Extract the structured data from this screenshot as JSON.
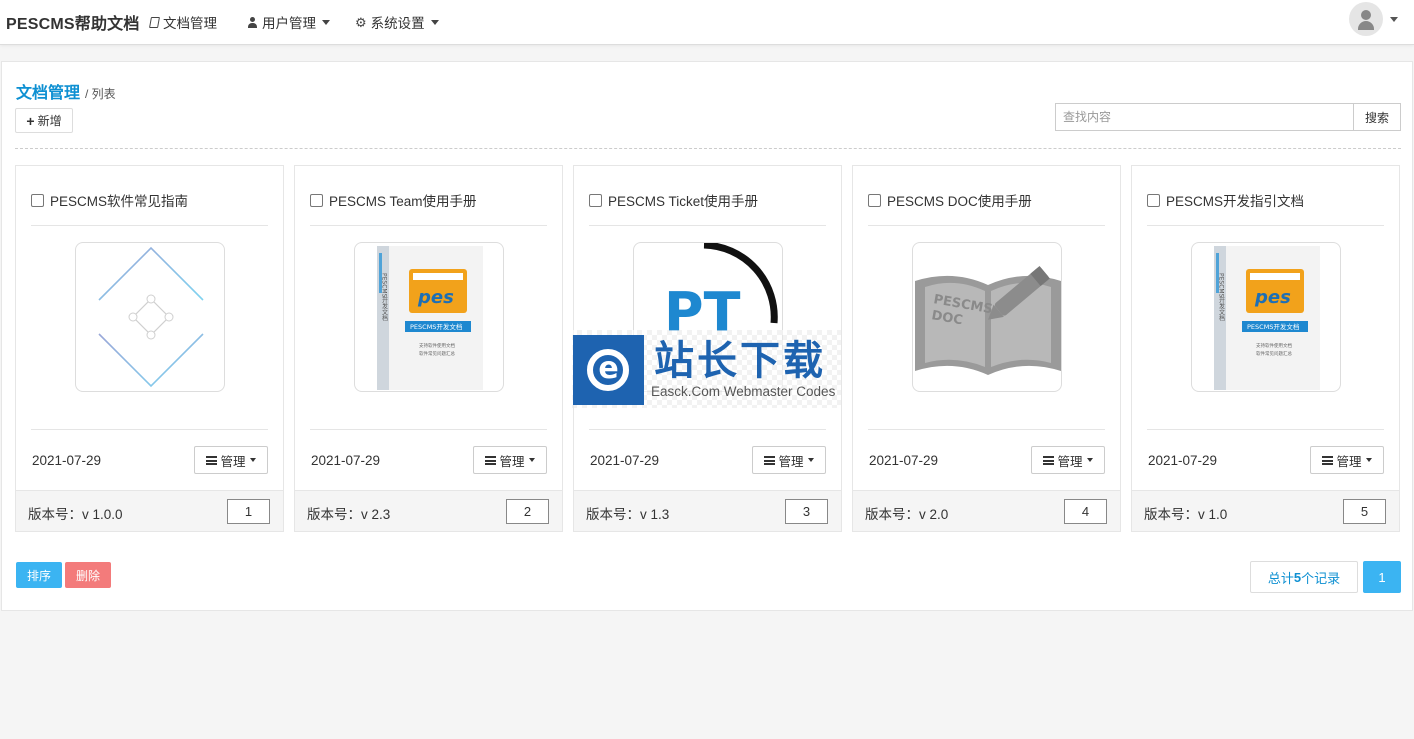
{
  "nav": {
    "brand": "PESCMS帮助文档",
    "items": [
      {
        "label": "文档管理",
        "icon": "book-icon"
      },
      {
        "label": "用户管理",
        "icon": "user-icon"
      },
      {
        "label": "系统设置",
        "icon": "gear-icon"
      }
    ]
  },
  "breadcrumb": {
    "title": "文档管理",
    "sub": "/ 列表"
  },
  "toolbar": {
    "add_label": "新增"
  },
  "search": {
    "placeholder": "查找内容",
    "button_label": "搜索"
  },
  "cards": [
    {
      "title": "PESCMS软件常见指南",
      "date": "2021-07-29",
      "manage_label": "管理",
      "version": "版本号：v 1.0.0",
      "sort": "1",
      "thumb": "diamond-logo"
    },
    {
      "title": "PESCMS Team使用手册",
      "date": "2021-07-29",
      "manage_label": "管理",
      "version": "版本号：v 2.3",
      "sort": "2",
      "thumb": "pes-book-cover"
    },
    {
      "title": "PESCMS Ticket使用手册",
      "date": "2021-07-29",
      "manage_label": "管理",
      "version": "版本号：v 1.3",
      "sort": "3",
      "thumb": "pt-logo"
    },
    {
      "title": "PESCMS DOC使用手册",
      "date": "2021-07-29",
      "manage_label": "管理",
      "version": "版本号：v 2.0",
      "sort": "4",
      "thumb": "pescms-doc-logo"
    },
    {
      "title": "PESCMS开发指引文档",
      "date": "2021-07-29",
      "manage_label": "管理",
      "version": "版本号：v 1.0",
      "sort": "5",
      "thumb": "pes-book-cover"
    }
  ],
  "bottom": {
    "sort_label": "排序",
    "delete_label": "删除",
    "total_prefix": "总计",
    "total_count": "5",
    "total_suffix": "个记录",
    "current_page": "1"
  },
  "watermark": {
    "cn": "站长下载",
    "en": "Easck.Com Webmaster Codes"
  },
  "thumb_text": {
    "pes_logo": "pes",
    "pes_band": "PESCMS开发文档",
    "pes_sub1": "支持软件使用文档",
    "pes_sub2": "软件常见问题汇总",
    "pes_spine": "PESCMS开发文档",
    "pt_logo": "PT",
    "doc_line1": "PESCMS",
    "doc_line2": "DOC"
  },
  "colors": {
    "accent": "#0e90d2",
    "primary_button": "#3bb4f2",
    "danger_button": "#f37b7b",
    "watermark_blue": "#1e63b0"
  }
}
